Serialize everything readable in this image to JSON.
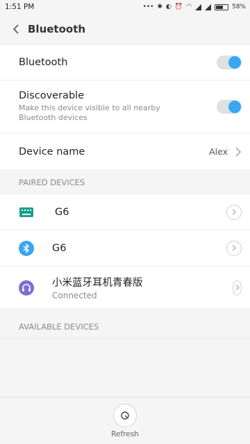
{
  "status_bar": {
    "time": "1:51 PM",
    "battery": "58%"
  },
  "header": {
    "title": "Bluetooth"
  },
  "settings": {
    "bluetooth": {
      "label": "Bluetooth",
      "enabled": true
    },
    "discoverable": {
      "label": "Discoverable",
      "description": "Make this device visible to all nearby Bluetooth devices",
      "enabled": true
    },
    "device_name": {
      "label": "Device name",
      "value": "Alex"
    }
  },
  "paired": {
    "header": "PAIRED DEVICES",
    "devices": [
      {
        "name": "G6",
        "icon": "keyboard-icon",
        "status": ""
      },
      {
        "name": "G6",
        "icon": "bluetooth-icon",
        "status": ""
      },
      {
        "name": "小米蓝牙耳机青春版",
        "icon": "headphones-icon",
        "status": "Connected"
      }
    ]
  },
  "available": {
    "header": "AVAILABLE DEVICES"
  },
  "footer": {
    "refresh_label": "Refresh"
  },
  "colors": {
    "accent": "#3aa6f0",
    "keyboard_icon": "#1a9f8c",
    "headset_icon": "#7b6fd0"
  }
}
